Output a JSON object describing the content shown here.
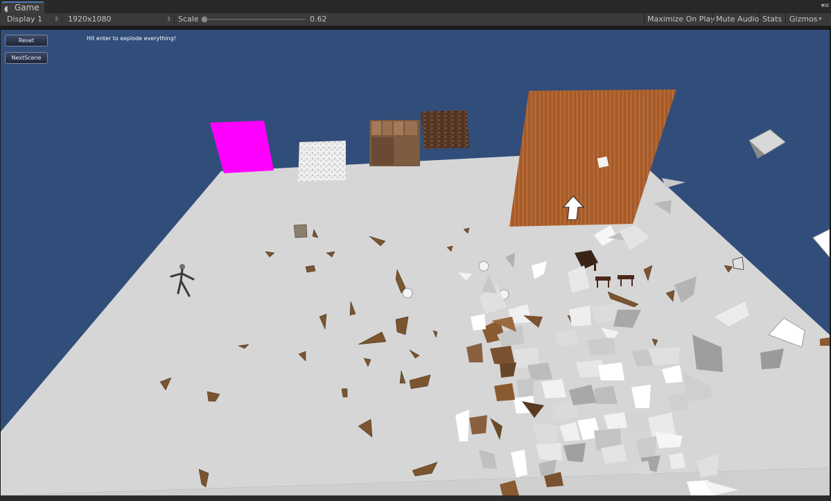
{
  "tab": {
    "title": "Game",
    "icon": "pacman-icon"
  },
  "toolbar": {
    "display": "Display 1",
    "resolution": "1920x1080",
    "scale_label": "Scale",
    "scale_value": "0.62",
    "maximize_on_play": "Maximize On Play",
    "mute_audio": "Mute Audio",
    "stats": "Stats",
    "gizmos": "Gizmos"
  },
  "overlay": {
    "reset_button": "Reset",
    "next_scene_button": "NextScene",
    "hint": "Hit enter to explode everything!"
  },
  "colors": {
    "sky": "#314d7a",
    "floor": "#d6d6d6",
    "magenta_panel": "#ff00ff",
    "wood": "#a05a2c",
    "debris_light": "#e8e8e8",
    "debris_wood": "#6b4a2a"
  }
}
